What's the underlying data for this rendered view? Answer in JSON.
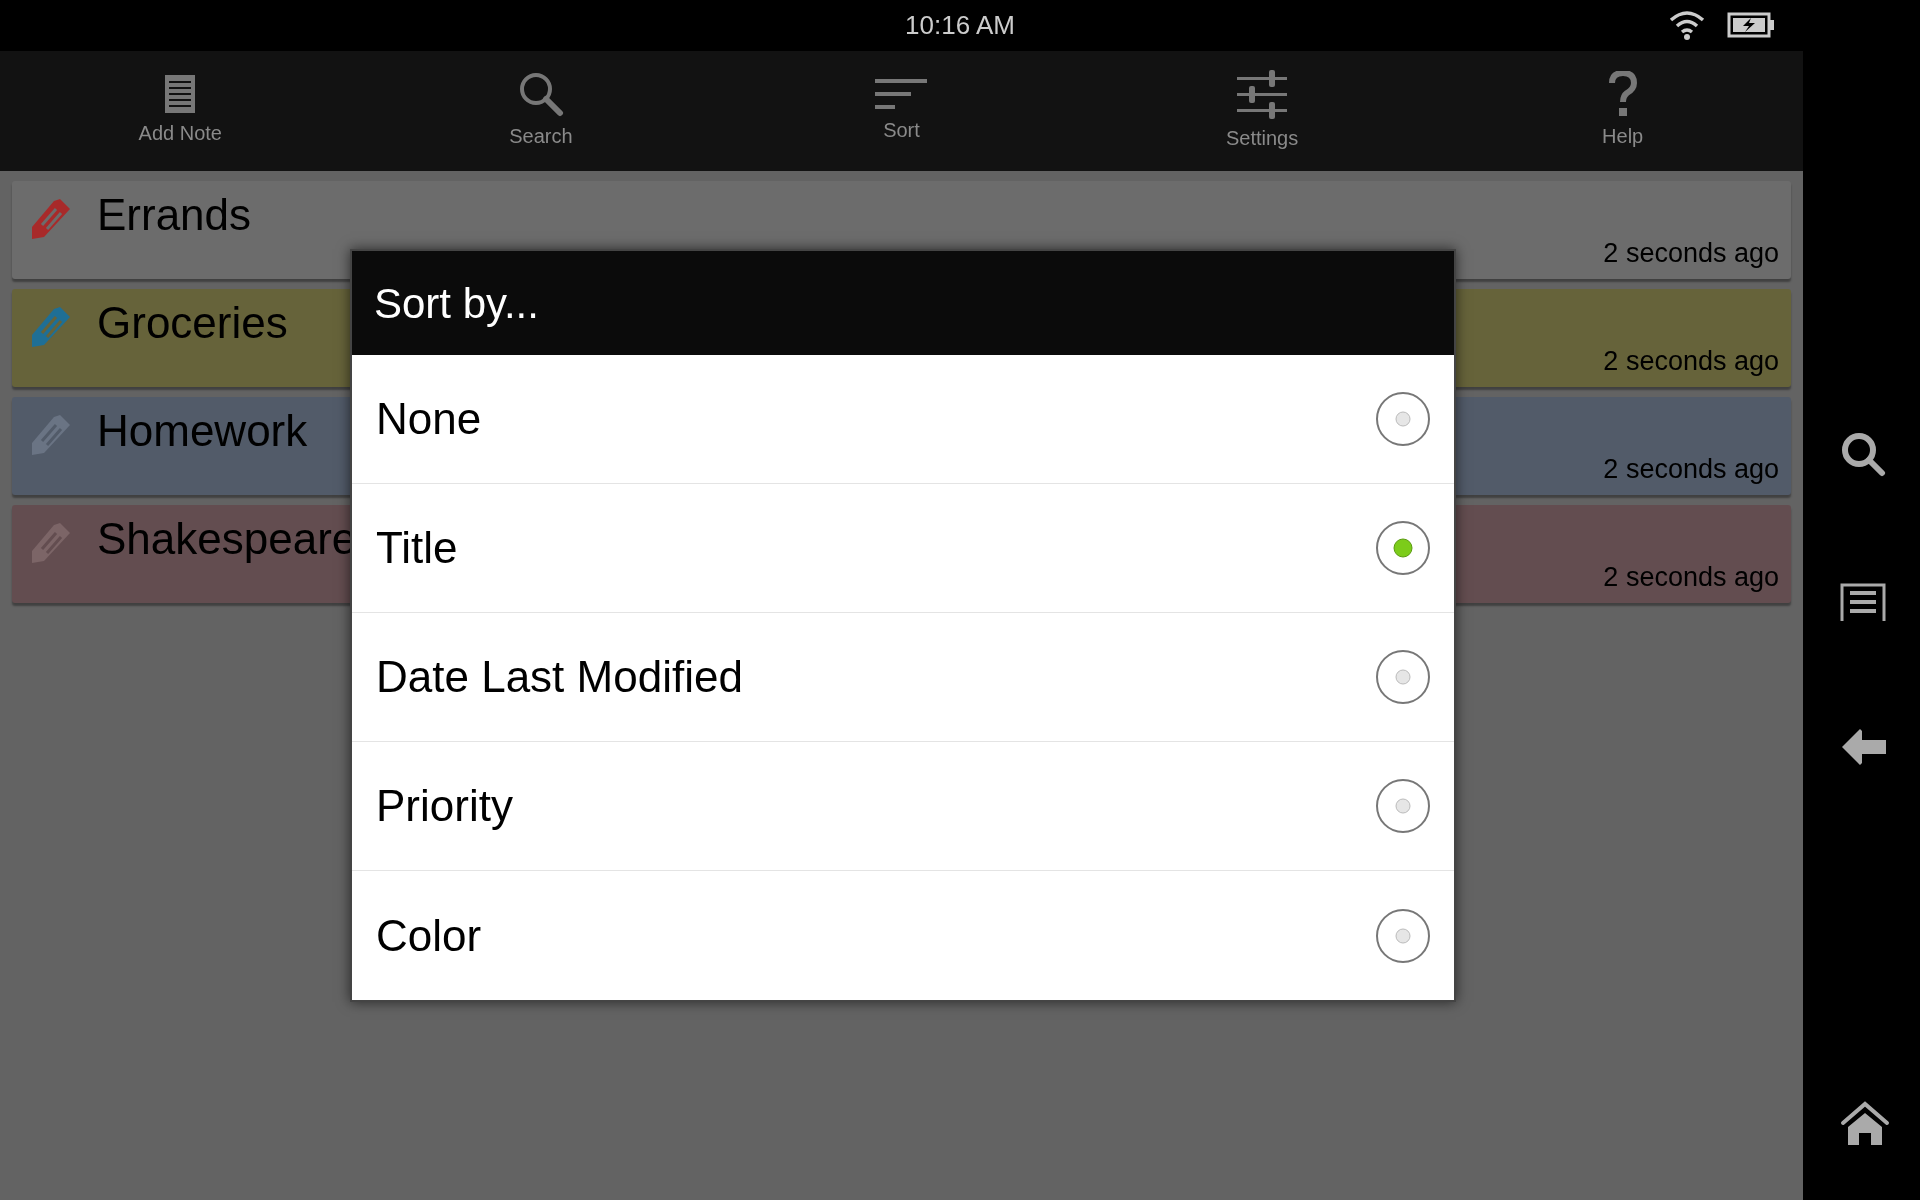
{
  "status_bar": {
    "time": "10:16 AM"
  },
  "toolbar": [
    {
      "label": "Add Note",
      "kind": "note"
    },
    {
      "label": "Search",
      "kind": "search"
    },
    {
      "label": "Sort",
      "kind": "sort"
    },
    {
      "label": "Settings",
      "kind": "settings"
    },
    {
      "label": "Help",
      "kind": "help"
    }
  ],
  "notes": [
    {
      "title": "Errands",
      "time": "2 seconds ago",
      "color": "#6c6c6c",
      "tag": {
        "color": "#a82a2a"
      }
    },
    {
      "title": "Groceries",
      "time": "2 seconds ago",
      "color": "#66633a",
      "tag": {
        "color": "#1f6f95"
      }
    },
    {
      "title": "Homework",
      "time": "2 seconds ago",
      "color": "#525b69",
      "tag": {
        "color": "#6a7484"
      }
    },
    {
      "title": "Shakespeare",
      "time": "2 seconds ago",
      "color": "#634d50",
      "tag": {
        "color": "#7c6567"
      }
    }
  ],
  "dialog": {
    "title": "Sort by...",
    "options": [
      {
        "label": "None",
        "selected": false
      },
      {
        "label": "Title",
        "selected": true
      },
      {
        "label": "Date Last Modified",
        "selected": false
      },
      {
        "label": "Priority",
        "selected": false
      },
      {
        "label": "Color",
        "selected": false
      }
    ]
  }
}
